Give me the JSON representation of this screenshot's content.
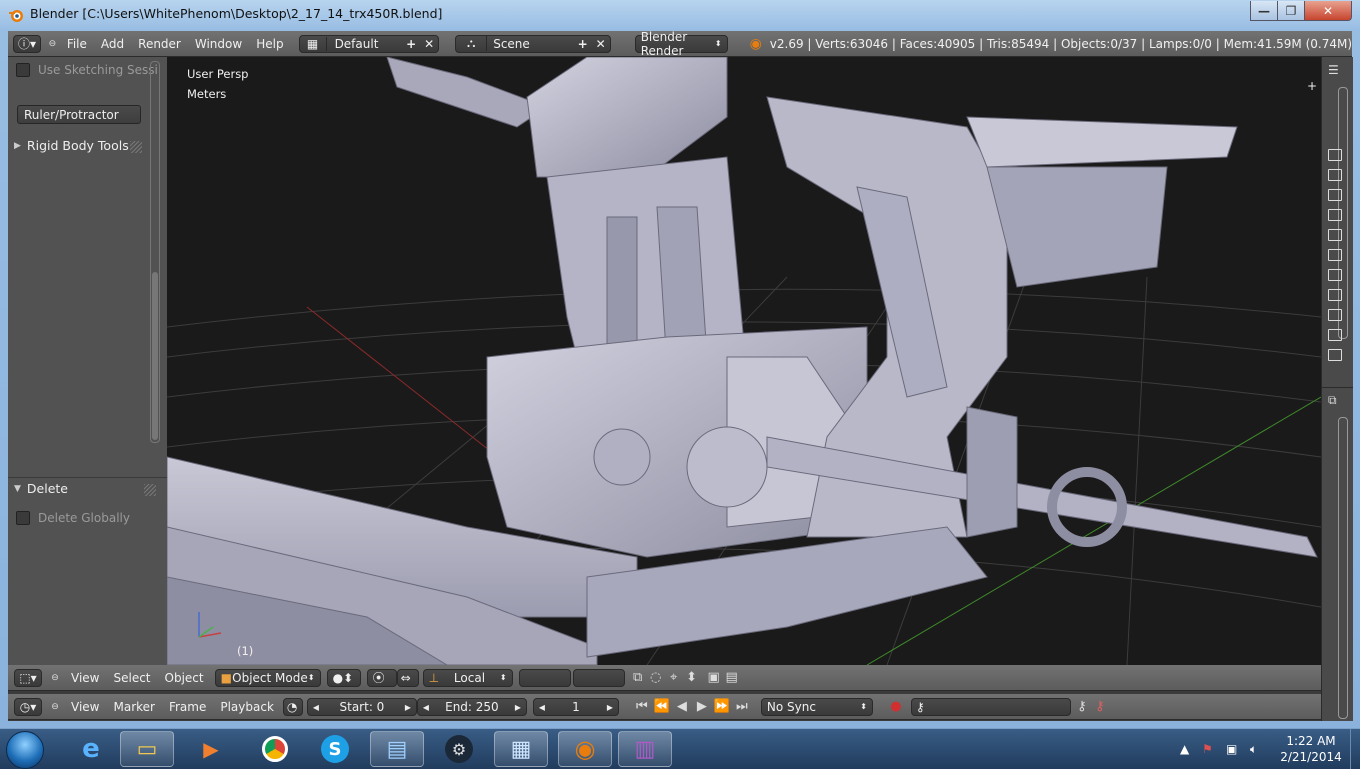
{
  "window": {
    "title": "Blender  [C:\\Users\\WhitePhenom\\Desktop\\2_17_14_trx450R.blend]",
    "min_label": "—",
    "max_label": "❐",
    "close_label": "✕"
  },
  "info_header": {
    "menus": [
      "File",
      "Add",
      "Render",
      "Window",
      "Help"
    ],
    "screen_layout": "Default",
    "scene": "Scene",
    "render_engine": "Blender Render",
    "stats": "v2.69 | Verts:63046 | Faces:40905 | Tris:85494 | Objects:0/37 | Lamps:0/0 | Mem:41.59M (0.74M)"
  },
  "tool_shelf": {
    "use_sketching_label": "Use Sketching Sessi",
    "ruler_button": "Ruler/Protractor",
    "rigid_body_panel": "Rigid Body Tools",
    "delete_panel": "Delete",
    "delete_globally_label": "Delete Globally"
  },
  "viewport": {
    "view_name": "User Persp",
    "units": "Meters",
    "frame_indicator": "(1)"
  },
  "view3d_header": {
    "menus": [
      "View",
      "Select",
      "Object"
    ],
    "mode": "Object Mode",
    "orientation": "Local"
  },
  "timeline_header": {
    "menus": [
      "View",
      "Marker",
      "Frame",
      "Playback"
    ],
    "start": "Start: 0",
    "end": "End: 250",
    "current_frame": "1",
    "sync": "No Sync"
  },
  "taskbar": {
    "time": "1:22 AM",
    "date": "2/21/2014",
    "apps": [
      "start",
      "internet-explorer",
      "file-explorer",
      "media-player",
      "chrome",
      "skype",
      "photo-viewer",
      "steam",
      "control-panel",
      "blender",
      "winrar"
    ]
  },
  "colors": {
    "viewport_bg": "#1a1a1a",
    "panel_bg": "#525252",
    "header_bg": "#666666",
    "model_color": "#b8b8c8",
    "grid_line": "#3c3c3c",
    "x_axis": "#8a2a2a",
    "y_axis": "#3f8a2a"
  }
}
